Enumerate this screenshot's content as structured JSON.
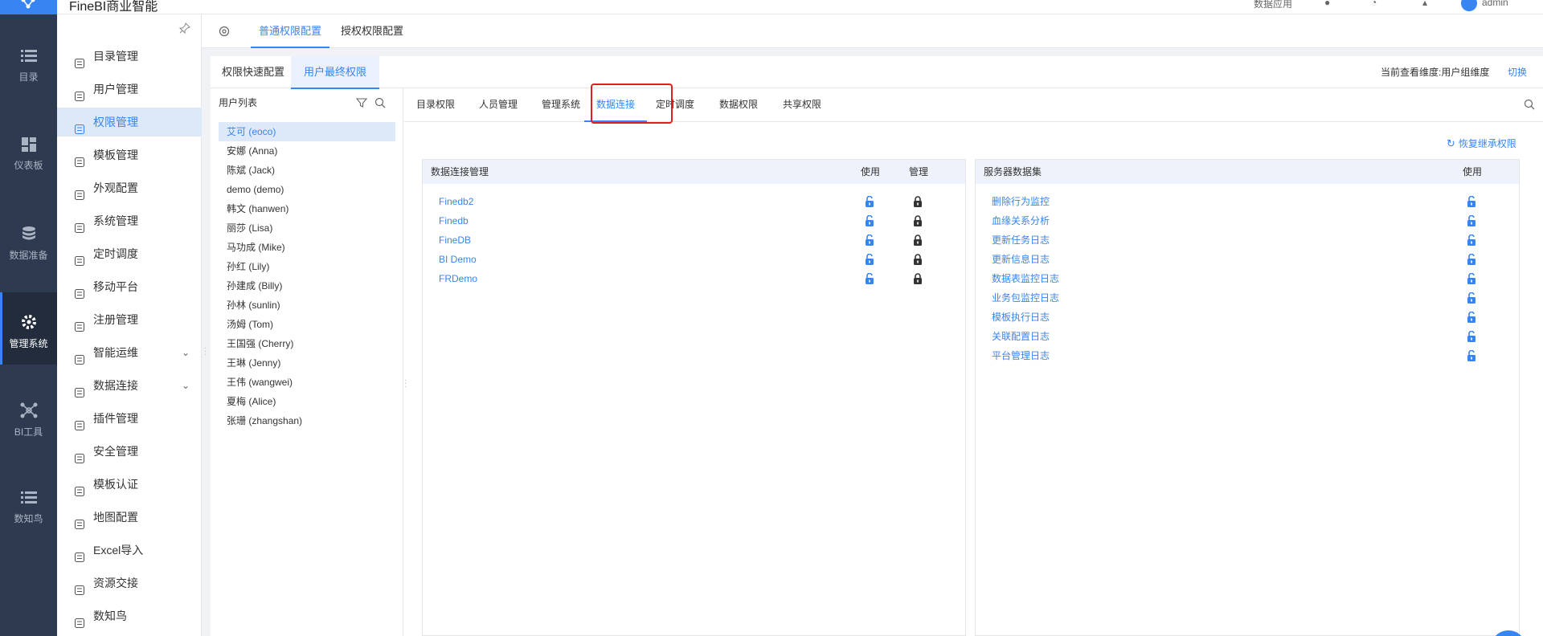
{
  "header": {
    "app_title": "FineBI商业智能",
    "right_items": [
      "数据应用",
      "admin"
    ]
  },
  "darknav": {
    "items": [
      {
        "label": "目录",
        "icon": "list-icon"
      },
      {
        "label": "仪表板",
        "icon": "dashboard-icon"
      },
      {
        "label": "数据准备",
        "icon": "database-icon"
      },
      {
        "label": "管理系统",
        "icon": "gear-icon",
        "active": true
      },
      {
        "label": "BI工具",
        "icon": "tools-icon"
      },
      {
        "label": "数知鸟",
        "icon": "list-icon"
      }
    ]
  },
  "sidebar": {
    "items": [
      {
        "label": "目录管理",
        "icon": "catalog-icon"
      },
      {
        "label": "用户管理",
        "icon": "user-icon"
      },
      {
        "label": "权限管理",
        "icon": "lock-icon",
        "active": true
      },
      {
        "label": "模板管理",
        "icon": "template-icon"
      },
      {
        "label": "外观配置",
        "icon": "paint-icon"
      },
      {
        "label": "系统管理",
        "icon": "gear-icon"
      },
      {
        "label": "定时调度",
        "icon": "timer-icon"
      },
      {
        "label": "移动平台",
        "icon": "mobile-icon"
      },
      {
        "label": "注册管理",
        "icon": "register-icon"
      },
      {
        "label": "智能运维",
        "icon": "ops-icon",
        "expandable": true
      },
      {
        "label": "数据连接",
        "icon": "link-icon",
        "expandable": true
      },
      {
        "label": "插件管理",
        "icon": "plugin-icon"
      },
      {
        "label": "安全管理",
        "icon": "shield-icon"
      },
      {
        "label": "模板认证",
        "icon": "cert-icon"
      },
      {
        "label": "地图配置",
        "icon": "map-icon"
      },
      {
        "label": "Excel导入",
        "icon": "excel-icon"
      },
      {
        "label": "资源交接",
        "icon": "handover-icon"
      },
      {
        "label": "数知鸟",
        "icon": "bird-icon"
      }
    ]
  },
  "tabs": {
    "normal": "普通权限配置",
    "grant": "授权权限配置"
  },
  "subtabs": {
    "quick": "权限快速配置",
    "final": "用户最终权限",
    "dim_label": "当前查看维度:用户组维度",
    "switch": "切换"
  },
  "userlist": {
    "title": "用户列表",
    "users": [
      "艾可 (eoco)",
      "安娜 (Anna)",
      "陈斌 (Jack)",
      "demo (demo)",
      "韩文 (hanwen)",
      "丽莎 (Lisa)",
      "马功成 (Mike)",
      "孙红 (Lily)",
      "孙建成 (Billy)",
      "孙林 (sunlin)",
      "汤姆 (Tom)",
      "王国强 (Cherry)",
      "王琳 (Jenny)",
      "王伟 (wangwei)",
      "夏梅 (Alice)",
      "张珊 (zhangshan)"
    ]
  },
  "perm_tabs": [
    "目录权限",
    "人员管理",
    "管理系统",
    "数据连接",
    "定时调度",
    "数据权限",
    "共享权限"
  ],
  "restore": "恢复继承权限",
  "conn_box": {
    "title": "数据连接管理",
    "col_use": "使用",
    "col_manage": "管理",
    "rows": [
      "Finedb2",
      "Finedb",
      "FineDB",
      "BI Demo",
      "FRDemo"
    ]
  },
  "server_box": {
    "title": "服务器数据集",
    "col_use": "使用",
    "rows": [
      "删除行为监控",
      "血缘关系分析",
      "更新任务日志",
      "更新信息日志",
      "数据表监控日志",
      "业务包监控日志",
      "模板执行日志",
      "关联配置日志",
      "平台管理日志"
    ]
  },
  "colors": {
    "accent": "#3685f2",
    "nav_bg": "#2e3a4f",
    "highlight": "#e02020"
  }
}
